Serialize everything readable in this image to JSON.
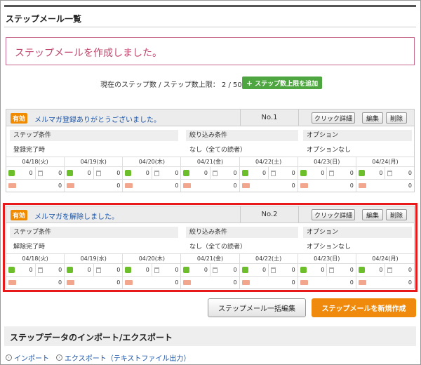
{
  "page": {
    "title": "ステップメール一覧"
  },
  "notice": "ステップメールを作成しました。",
  "summary": {
    "text": "現在のステップ数 / ステップ数上限： 2 / 50",
    "add_button": "ステップ数上限を追加"
  },
  "mails": [
    {
      "status": "有効",
      "title": "メルマガ登録ありがとうございました。",
      "number": "No.1",
      "detail_button": "クリック詳細",
      "edit_button": "編集",
      "delete_button": "削除",
      "step_condition_label": "ステップ条件",
      "step_condition_value": "登録完了時",
      "filter_label": "絞り込み条件",
      "filter_value": "なし（全ての読者）",
      "option_label": "オプション",
      "option_value": "オプションなし",
      "days": [
        {
          "date": "04/18(火)",
          "a": "0",
          "b": "0",
          "c": "0"
        },
        {
          "date": "04/19(水)",
          "a": "0",
          "b": "0",
          "c": "0"
        },
        {
          "date": "04/20(木)",
          "a": "0",
          "b": "0",
          "c": "0"
        },
        {
          "date": "04/21(金)",
          "a": "0",
          "b": "0",
          "c": "0"
        },
        {
          "date": "04/22(土)",
          "a": "0",
          "b": "0",
          "c": "0"
        },
        {
          "date": "04/23(日)",
          "a": "0",
          "b": "0",
          "c": "0"
        },
        {
          "date": "04/24(月)",
          "a": "0",
          "b": "0",
          "c": "0"
        }
      ]
    },
    {
      "status": "有効",
      "title": "メルマガを解除しました。",
      "number": "No.2",
      "detail_button": "クリック詳細",
      "edit_button": "編集",
      "delete_button": "削除",
      "step_condition_label": "ステップ条件",
      "step_condition_value": "解除完了時",
      "filter_label": "絞り込み条件",
      "filter_value": "なし（全ての読者）",
      "option_label": "オプション",
      "option_value": "オプションなし",
      "days": [
        {
          "date": "04/18(火)",
          "a": "0",
          "b": "0",
          "c": "0"
        },
        {
          "date": "04/19(水)",
          "a": "0",
          "b": "0",
          "c": "0"
        },
        {
          "date": "04/20(木)",
          "a": "0",
          "b": "0",
          "c": "0"
        },
        {
          "date": "04/21(金)",
          "a": "0",
          "b": "0",
          "c": "0"
        },
        {
          "date": "04/22(土)",
          "a": "0",
          "b": "0",
          "c": "0"
        },
        {
          "date": "04/23(日)",
          "a": "0",
          "b": "0",
          "c": "0"
        },
        {
          "date": "04/24(月)",
          "a": "0",
          "b": "0",
          "c": "0"
        }
      ]
    }
  ],
  "actions": {
    "bulk_edit": "ステップメール一括編集",
    "create_new": "ステップメールを新規作成"
  },
  "io": {
    "title": "ステップデータのインポート/エクスポート",
    "import": "インポート",
    "export": "エクスポート（テキストファイル出力）"
  },
  "colors": {
    "accent_orange": "#f08a0c",
    "green": "#4ea640",
    "highlight_red": "#e8191b",
    "notice_pink": "#c0486e",
    "link_blue": "#1a54a8"
  },
  "icons": [
    "user-icon",
    "trash-icon",
    "mail-icon",
    "plus-icon",
    "circle-arrow-icon"
  ]
}
